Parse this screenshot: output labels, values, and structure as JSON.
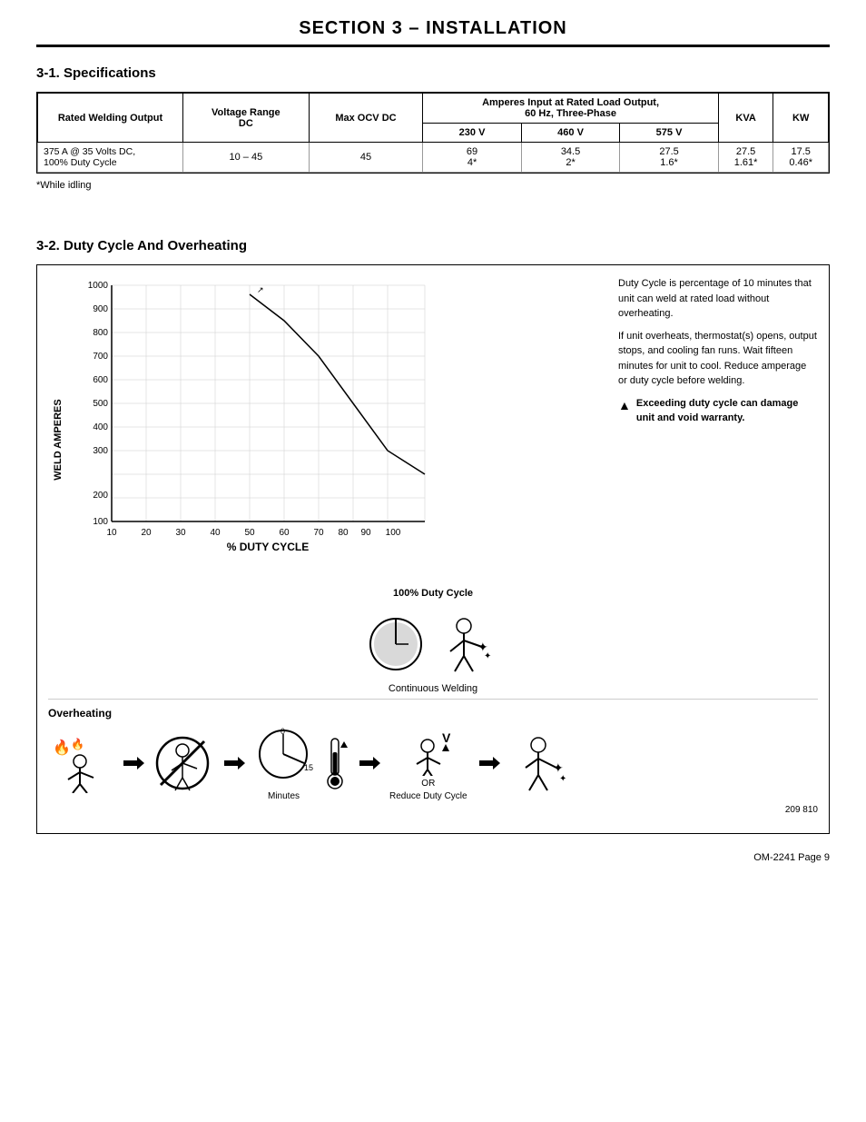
{
  "page": {
    "section_title": "SECTION 3 – INSTALLATION",
    "page_number": "OM-2241 Page 9"
  },
  "section31": {
    "heading": "3-1.   Specifications",
    "table": {
      "header_row1": {
        "col1": "",
        "col2": "Voltage Range\nDC",
        "col3": "Max OCV DC",
        "col4_span": "Amperes Input at Rated Load Output, 60 Hz, Three-Phase",
        "col4a": "230 V",
        "col4b": "460 V",
        "col4c": "575 V",
        "col5": "KVA",
        "col6": "KW"
      },
      "col1_label": "Rated Welding Output",
      "data_row": {
        "col1": "375 A @ 35 Volts DC,\n100% Duty Cycle",
        "col2": "10 – 45",
        "col3": "45",
        "col4a": "69\n4*",
        "col4b": "34.5\n2*",
        "col4c": "27.5\n1.6*",
        "col5": "27.5\n1.61*",
        "col6": "17.5\n0.46*"
      },
      "footnote": "*While idling"
    }
  },
  "section32": {
    "heading": "3-2.   Duty Cycle And Overheating",
    "chart": {
      "y_axis_label": "WELD AMPERES",
      "x_axis_label": "% DUTY CYCLE",
      "y_values": [
        "1000",
        "900",
        "800",
        "700",
        "600",
        "500",
        "400",
        "300",
        "200",
        "100"
      ],
      "x_values": [
        "10",
        "20",
        "30",
        "40",
        "50",
        "60",
        "70",
        "80",
        "90",
        "100"
      ]
    },
    "side_text": [
      "Duty Cycle is percentage of 10 minutes that unit can weld at rated load without overheating.",
      "If unit overheats, thermostat(s) opens, output stops, and cooling fan runs. Wait fifteen minutes for unit to cool. Reduce amperage or duty cycle before welding.",
      "Exceeding duty cycle can damage unit and void warranty."
    ],
    "duty100_label": "100% Duty Cycle",
    "continuous_welding_label": "Continuous Welding",
    "overheating_label": "Overheating",
    "minutes_label": "Minutes",
    "or_label": "OR",
    "reduce_duty_cycle_label": "Reduce Duty Cycle",
    "fig_number": "209 810"
  }
}
